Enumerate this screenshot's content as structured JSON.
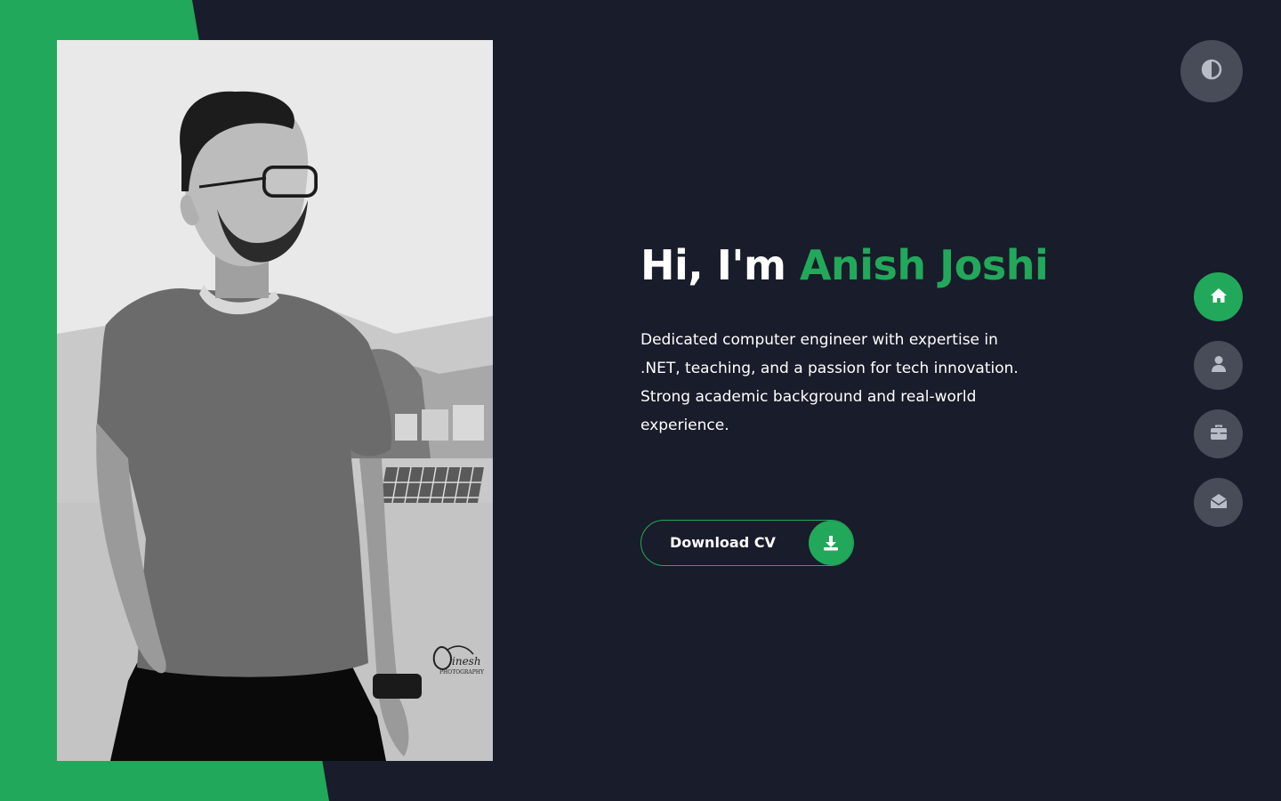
{
  "colors": {
    "background": "#191c2a",
    "accent": "#22a85a",
    "button_gray": "#474c58",
    "text": "#ffffff"
  },
  "hero": {
    "greeting": "Hi, I'm",
    "name": "Anish Joshi",
    "description": "Dedicated computer engineer with expertise in .NET, teaching, and a passion for tech innovation. Strong academic background and real-world experience."
  },
  "cv_button": {
    "label": "Download CV",
    "icon": "download-icon"
  },
  "theme_toggle": {
    "icon": "contrast-icon"
  },
  "side_nav": {
    "items": [
      {
        "icon": "home-icon",
        "active": true
      },
      {
        "icon": "user-icon",
        "active": false
      },
      {
        "icon": "briefcase-icon",
        "active": false
      },
      {
        "icon": "envelope-open-icon",
        "active": false
      }
    ]
  },
  "photo": {
    "description": "Black and white portrait photo",
    "watermark": "Dinesh PHOTOGRAPHY"
  }
}
